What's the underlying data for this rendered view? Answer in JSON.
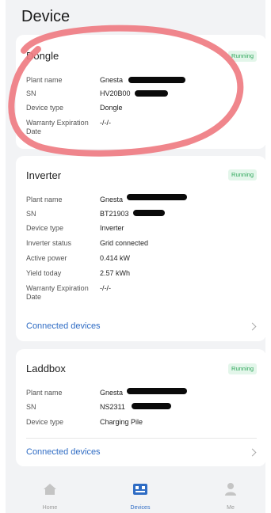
{
  "header": {
    "title": "Device"
  },
  "cards": [
    {
      "title": "Dongle",
      "status": "Running",
      "rows": [
        {
          "label": "Plant name",
          "value": "Gnesta"
        },
        {
          "label": "SN",
          "value": "HV20B00"
        },
        {
          "label": "Device type",
          "value": "Dongle"
        },
        {
          "label": "Warranty Expiration Date",
          "value": "-/-/-"
        }
      ]
    },
    {
      "title": "Inverter",
      "status": "Running",
      "rows": [
        {
          "label": "Plant name",
          "value": "Gnesta"
        },
        {
          "label": "SN",
          "value": "BT21903"
        },
        {
          "label": "Device type",
          "value": "Inverter"
        },
        {
          "label": "Inverter status",
          "value": "Grid connected"
        },
        {
          "label": "Active power",
          "value": "0.414 kW"
        },
        {
          "label": "Yield today",
          "value": "2.57 kWh"
        },
        {
          "label": "Warranty Expiration Date",
          "value": "-/-/-"
        }
      ],
      "link": "Connected devices"
    },
    {
      "title": "Laddbox",
      "status": "Running",
      "rows": [
        {
          "label": "Plant name",
          "value": "Gnesta"
        },
        {
          "label": "SN",
          "value": "NS2311"
        },
        {
          "label": "Device type",
          "value": "Charging Pile"
        }
      ],
      "link": "Connected devices"
    }
  ],
  "tabbar": {
    "items": [
      {
        "label": "Home",
        "icon": "home-icon"
      },
      {
        "label": "Devices",
        "icon": "devices-icon"
      },
      {
        "label": "Me",
        "icon": "person-icon"
      }
    ],
    "active": "Devices"
  },
  "colors": {
    "accent": "#2f6cc4",
    "badge_bg": "#e3f6ea",
    "badge_text": "#2ea65a",
    "annotation": "#ef7c82"
  }
}
